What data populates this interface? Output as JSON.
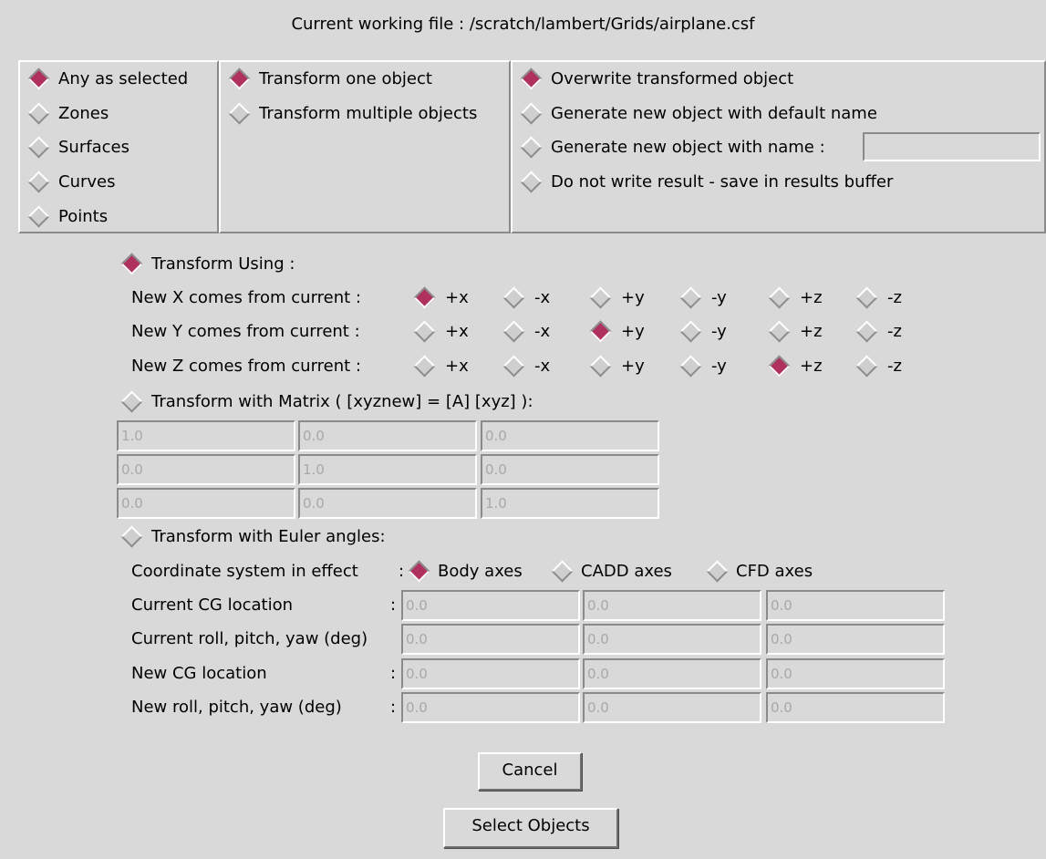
{
  "window": {
    "working_file": "Current working file : /scratch/lambert/Grids/airplane.csf"
  },
  "object_types": [
    {
      "label": "Any as selected",
      "selected": true
    },
    {
      "label": "Zones",
      "selected": false
    },
    {
      "label": "Surfaces",
      "selected": false
    },
    {
      "label": "Curves",
      "selected": false
    },
    {
      "label": "Points",
      "selected": false
    }
  ],
  "transform_count": [
    {
      "label": "Transform one object",
      "selected": true
    },
    {
      "label": "Transform multiple objects",
      "selected": false
    }
  ],
  "output_options": [
    {
      "label": "Overwrite transformed object",
      "selected": true
    },
    {
      "label": "Generate new object with default name",
      "selected": false
    },
    {
      "label": "Generate new object with name :",
      "selected": false
    },
    {
      "label": "Do not write result - save in results buffer",
      "selected": false
    }
  ],
  "output_name_value": "",
  "transform_using": {
    "label": "Transform Using :",
    "selected": true,
    "rows": [
      {
        "label": "New X comes from current :",
        "selected": "+x"
      },
      {
        "label": "New Y comes from current :",
        "selected": "+y"
      },
      {
        "label": "New Z comes from current :",
        "selected": "+z"
      }
    ],
    "options": [
      "+x",
      "-x",
      "+y",
      "-y",
      "+z",
      "-z"
    ]
  },
  "matrix": {
    "label": "Transform with Matrix ( [xyznew] = [A] [xyz] ):",
    "selected": false,
    "values": [
      [
        "1.0",
        "0.0",
        "0.0"
      ],
      [
        "0.0",
        "1.0",
        "0.0"
      ],
      [
        "0.0",
        "0.0",
        "1.0"
      ]
    ]
  },
  "euler": {
    "label": "Transform with Euler angles:",
    "selected": false,
    "coord_label": "Coordinate system in effect",
    "coord_options": [
      {
        "label": "Body axes",
        "selected": true
      },
      {
        "label": "CADD axes",
        "selected": false
      },
      {
        "label": "CFD axes",
        "selected": false
      }
    ],
    "rows": [
      {
        "label": "Current CG location",
        "values": [
          "0.0",
          "0.0",
          "0.0"
        ]
      },
      {
        "label": "Current roll, pitch, yaw (deg)",
        "values": [
          "0.0",
          "0.0",
          "0.0"
        ]
      },
      {
        "label": "New CG location",
        "values": [
          "0.0",
          "0.0",
          "0.0"
        ]
      },
      {
        "label": "New roll, pitch, yaw (deg)",
        "values": [
          "0.0",
          "0.0",
          "0.0"
        ]
      }
    ]
  },
  "buttons": {
    "cancel": "Cancel",
    "select_objects": "Select Objects"
  },
  "colors": {
    "selected_radio": "#b03060",
    "background": "#d9d9d9"
  }
}
